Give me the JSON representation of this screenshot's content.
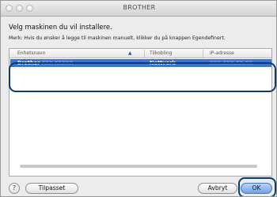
{
  "window": {
    "title": "BROTHER"
  },
  "dialog": {
    "heading": "Velg maskinen du vil installere.",
    "note": "Merk: Hvis du ønsker å legge til maskinen manuelt, klikker du på knappen Egendefinert."
  },
  "table": {
    "columns": [
      "Enhetsnavn",
      "▲",
      "Tilkobling",
      "IP-adresse"
    ],
    "rows": [
      {
        "name": "Brother",
        "name_masked": "XXX-XXXXX",
        "connection": "Nettverk",
        "ip": "XXX.XXX.XX.XX",
        "selected": true
      }
    ]
  },
  "buttons": {
    "help": "?",
    "custom": "Tilpasset",
    "cancel": "Avbryt",
    "ok": "OK"
  },
  "colors": {
    "selection": "#3a74d4",
    "callout": "#0d3a70",
    "default_button": "#6fa3e6"
  },
  "icons": [
    "close-light-icon",
    "minimize-light-icon",
    "zoom-light-icon",
    "help-icon",
    "sort-ascending-icon"
  ]
}
